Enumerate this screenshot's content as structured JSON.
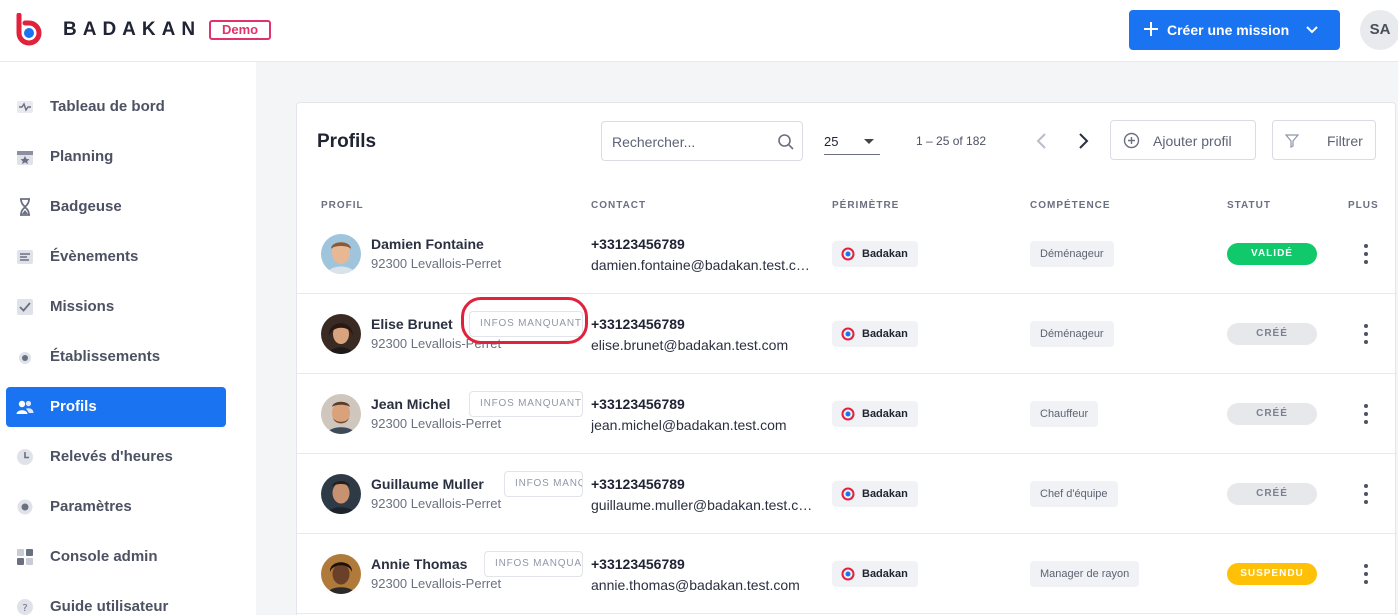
{
  "header": {
    "brand": "BADAKAN",
    "demo_label": "Demo",
    "create_button_label": "Créer une mission",
    "user_initials": "SA",
    "accent_color": "#1a73f0",
    "logo_color": "#e0223c"
  },
  "sidebar": {
    "items": [
      {
        "label": "Tableau de bord",
        "icon": "dashboard-icon"
      },
      {
        "label": "Planning",
        "icon": "calendar-icon"
      },
      {
        "label": "Badgeuse",
        "icon": "hourglass-icon"
      },
      {
        "label": "Évènements",
        "icon": "events-icon"
      },
      {
        "label": "Missions",
        "icon": "checklist-icon"
      },
      {
        "label": "Établissements",
        "icon": "location-icon"
      },
      {
        "label": "Profils",
        "icon": "users-icon",
        "active": true
      },
      {
        "label": "Relevés d'heures",
        "icon": "clock-icon"
      },
      {
        "label": "Paramètres",
        "icon": "gear-icon"
      },
      {
        "label": "Console admin",
        "icon": "admin-grid-icon"
      },
      {
        "label": "Guide utilisateur",
        "icon": "help-icon"
      }
    ]
  },
  "main": {
    "title": "Profils",
    "search_placeholder": "Rechercher...",
    "per_page": "25",
    "range": "1 – 25 of 182",
    "add_profile_label": "Ajouter profil",
    "filter_label": "Filtrer",
    "columns": {
      "profil": "PROFIL",
      "contact": "CONTACT",
      "perimetre": "PÉRIMÈTRE",
      "competence": "COMPÉTENCE",
      "statut": "STATUT",
      "plus": "PLUS"
    },
    "rows": [
      {
        "name": "Damien Fontaine",
        "city": "92300 Levallois-Perret",
        "missing": "",
        "phone": "+33123456789",
        "email": "damien.fontaine@badakan.test.com",
        "perimeter": "Badakan",
        "skill": "Déménageur",
        "status": "VALIDÉ",
        "status_kind": "valid"
      },
      {
        "name": "Elise Brunet",
        "city": "92300 Levallois-Perret",
        "missing": "INFOS MANQUANTES",
        "phone": "+33123456789",
        "email": "elise.brunet@badakan.test.com",
        "perimeter": "Badakan",
        "skill": "Déménageur",
        "status": "CRÉÉ",
        "status_kind": "created"
      },
      {
        "name": "Jean Michel",
        "city": "92300 Levallois-Perret",
        "missing": "INFOS MANQUANTES",
        "phone": "+33123456789",
        "email": "jean.michel@badakan.test.com",
        "perimeter": "Badakan",
        "skill": "Chauffeur",
        "status": "CRÉÉ",
        "status_kind": "created"
      },
      {
        "name": "Guillaume Muller",
        "city": "92300 Levallois-Perret",
        "missing": "INFOS MANQUANTES",
        "phone": "+33123456789",
        "email": "guillaume.muller@badakan.test.com",
        "perimeter": "Badakan",
        "skill": "Chef d'équipe",
        "status": "CRÉÉ",
        "status_kind": "created"
      },
      {
        "name": "Annie Thomas",
        "city": "92300 Levallois-Perret",
        "missing": "INFOS MANQUANTES",
        "phone": "+33123456789",
        "email": "annie.thomas@badakan.test.com",
        "perimeter": "Badakan",
        "skill": "Manager de rayon",
        "status": "SUSPENDU",
        "status_kind": "suspended"
      }
    ],
    "status_colors": {
      "valid": "#10c96a",
      "created": "#e6e8ec",
      "suspended": "#ffc107"
    }
  }
}
